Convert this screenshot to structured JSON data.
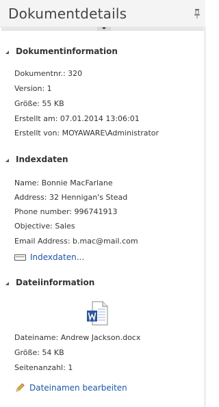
{
  "header": {
    "title": "Dokumentdetails"
  },
  "sections": [
    {
      "title": "Dokumentinformation",
      "rows": [
        "Dokumentnr.: 320",
        "Version: 1",
        "Größe: 55 KB",
        "Erstellt am: 07.01.2014 13:06:01",
        "Erstellt von: MOYAWARE\\Administrator"
      ]
    },
    {
      "title": "Indexdaten",
      "rows": [
        "Name: Bonnie MacFarlane",
        "Address: 32 Hennigan's Stead",
        "Phone number: 996741913",
        "Objective: Sales",
        "Email Address: b.mac@mail.com"
      ],
      "link": "Indexdaten..."
    },
    {
      "title": "Dateiinformation",
      "rows": [
        "Dateiname: Andrew Jackson.docx",
        "Größe: 54 KB",
        "Seitenanzahl: 1"
      ],
      "link": "Dateinamen bearbeiten"
    }
  ],
  "colors": {
    "link": "#1b56a6",
    "word_blue": "#2b579a"
  }
}
